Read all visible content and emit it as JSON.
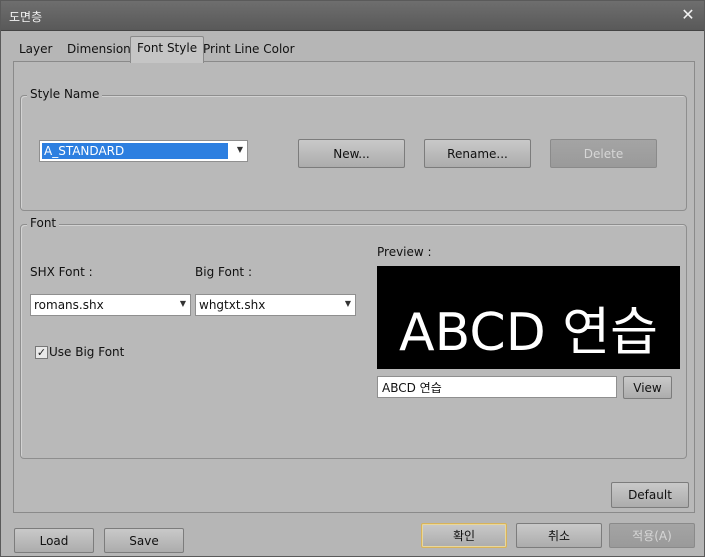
{
  "window": {
    "title": "도면층",
    "close_label": "✕"
  },
  "tabs": [
    {
      "label": "Layer",
      "active": false
    },
    {
      "label": "Dimension",
      "active": false
    },
    {
      "label": "Font Style",
      "active": true
    },
    {
      "label": "Print Line Color",
      "active": false
    }
  ],
  "style_name": {
    "group_label": "Style Name",
    "selected_value": "A_STANDARD",
    "new_label": "New...",
    "rename_label": "Rename...",
    "delete_label": "Delete"
  },
  "font": {
    "group_label": "Font",
    "shx_label": "SHX Font :",
    "shx_value": "romans.shx",
    "big_label": "Big Font :",
    "big_value": "whgtxt.shx",
    "use_big_font_label": "Use Big Font",
    "use_big_font_checked": true,
    "preview_label": "Preview :",
    "preview_text": "ABCD 연습",
    "preview_input_value": "ABCD 연습",
    "view_label": "View"
  },
  "footer": {
    "default_label": "Default",
    "load_label": "Load",
    "save_label": "Save",
    "ok_label": "확인",
    "cancel_label": "취소",
    "apply_label": "적용(A)"
  },
  "icons": {
    "dropdown": "chevron-down-icon",
    "close": "close-icon",
    "check": "check-icon"
  }
}
